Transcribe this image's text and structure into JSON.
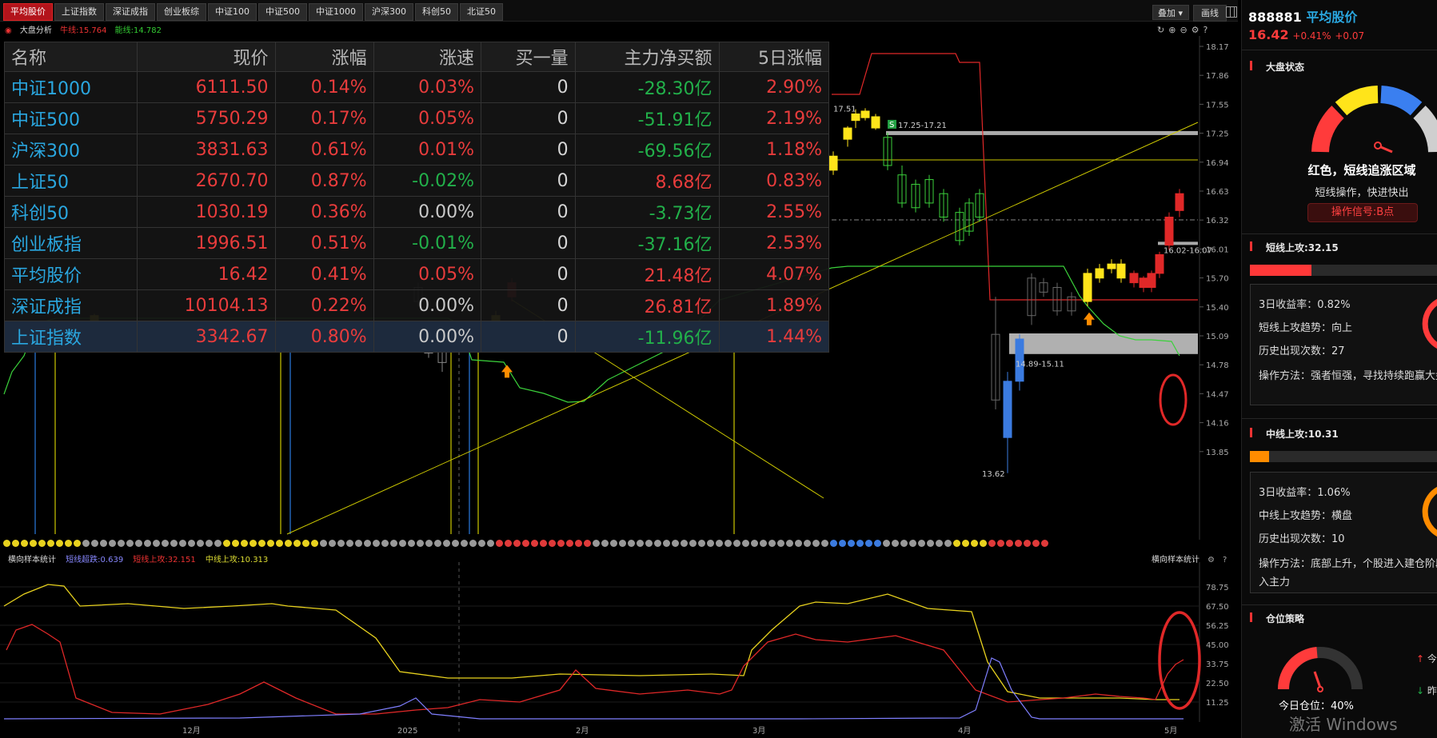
{
  "tabs": [
    "平均股价",
    "上证指数",
    "深证成指",
    "创业板综",
    "中证100",
    "中证500",
    "中证1000",
    "沪深300",
    "科创50",
    "北证50"
  ],
  "toolbar": {
    "overlay_label": "叠加",
    "draw_label": "画线"
  },
  "indicator_bar": {
    "name": "大盘分析",
    "bull_label": "牛线:15.764",
    "energy_label": "能线:14.782"
  },
  "main_chart": {
    "y_ticks": [
      "18.17",
      "17.86",
      "17.55",
      "17.25",
      "16.94",
      "16.63",
      "16.32",
      "16.01",
      "15.70",
      "15.40",
      "15.09",
      "14.78",
      "14.47",
      "14.16",
      "13.85"
    ],
    "annotations": {
      "high": "17.51",
      "resistance": "17.25-17.21",
      "support": "14.89-15.11",
      "range": "16.02-16.07",
      "low": "13.62"
    },
    "resistance_marker": "S"
  },
  "dot_colors": [
    "#e8d21e",
    "#e8d21e",
    "#e8d21e",
    "#e8d21e",
    "#e8d21e",
    "#e8d21e",
    "#e8d21e",
    "#e8d21e",
    "#e8d21e",
    "#999",
    "#999",
    "#999",
    "#999",
    "#999",
    "#999",
    "#999",
    "#999",
    "#999",
    "#999",
    "#999",
    "#999",
    "#999",
    "#999",
    "#999",
    "#999",
    "#e8d21e",
    "#e8d21e",
    "#e8d21e",
    "#e8d21e",
    "#e8d21e",
    "#e8d21e",
    "#e8d21e",
    "#e8d21e",
    "#e8d21e",
    "#e8d21e",
    "#e8d21e",
    "#999",
    "#999",
    "#999",
    "#999",
    "#999",
    "#999",
    "#999",
    "#999",
    "#999",
    "#999",
    "#999",
    "#999",
    "#999",
    "#999",
    "#999",
    "#999",
    "#999",
    "#999",
    "#999",
    "#999",
    "#e03a3a",
    "#e03a3a",
    "#e03a3a",
    "#e03a3a",
    "#e03a3a",
    "#e03a3a",
    "#e03a3a",
    "#e03a3a",
    "#e03a3a",
    "#e03a3a",
    "#e03a3a",
    "#999",
    "#999",
    "#999",
    "#999",
    "#999",
    "#999",
    "#999",
    "#999",
    "#999",
    "#999",
    "#999",
    "#999",
    "#999",
    "#999",
    "#999",
    "#999",
    "#999",
    "#999",
    "#999",
    "#999",
    "#999",
    "#999",
    "#999",
    "#999",
    "#999",
    "#999",
    "#999",
    "#3b7be0",
    "#3b7be0",
    "#3b7be0",
    "#3b7be0",
    "#3b7be0",
    "#3b7be0",
    "#999",
    "#999",
    "#999",
    "#999",
    "#999",
    "#999",
    "#999",
    "#999",
    "#e8d21e",
    "#e8d21e",
    "#e8d21e",
    "#e8d21e",
    "#e03a3a",
    "#e03a3a",
    "#e03a3a",
    "#e03a3a",
    "#e03a3a",
    "#e03a3a",
    "#e03a3a"
  ],
  "sub_chart": {
    "title": "横向样本统计",
    "right_title": "横向样本统计",
    "short_down": "短线超跌:0.639",
    "short_up": "短线上攻:32.151",
    "mid_up": "中线上攻:10.313",
    "y_ticks": [
      "78.75",
      "67.50",
      "56.25",
      "45.00",
      "33.75",
      "22.50",
      "11.25"
    ],
    "x_labels": [
      "12月",
      "2025",
      "2月",
      "3月",
      "4月",
      "5月"
    ]
  },
  "index_table": {
    "headers": [
      "名称",
      "现价",
      "涨幅",
      "涨速",
      "买一量",
      "主力净买额",
      "5日涨幅"
    ],
    "rows": [
      {
        "name": "中证1000",
        "price": "6111.50",
        "chg": "0.14%",
        "speed": "0.03%",
        "bid": "0",
        "net": "-28.30亿",
        "d5": "2.90%"
      },
      {
        "name": "中证500",
        "price": "5750.29",
        "chg": "0.17%",
        "speed": "0.05%",
        "bid": "0",
        "net": "-51.91亿",
        "d5": "2.19%"
      },
      {
        "name": "沪深300",
        "price": "3831.63",
        "chg": "0.61%",
        "speed": "0.01%",
        "bid": "0",
        "net": "-69.56亿",
        "d5": "1.18%"
      },
      {
        "name": "上证50",
        "price": "2670.70",
        "chg": "0.87%",
        "speed": "-0.02%",
        "bid": "0",
        "net": "8.68亿",
        "d5": "0.83%"
      },
      {
        "name": "科创50",
        "price": "1030.19",
        "chg": "0.36%",
        "speed": "0.00%",
        "bid": "0",
        "net": "-3.73亿",
        "d5": "2.55%"
      },
      {
        "name": "创业板指",
        "price": "1996.51",
        "chg": "0.51%",
        "speed": "-0.01%",
        "bid": "0",
        "net": "-37.16亿",
        "d5": "2.53%"
      },
      {
        "name": "平均股价",
        "price": "16.42",
        "chg": "0.41%",
        "speed": "0.05%",
        "bid": "0",
        "net": "21.48亿",
        "d5": "4.07%"
      },
      {
        "name": "深证成指",
        "price": "10104.13",
        "chg": "0.22%",
        "speed": "0.00%",
        "bid": "0",
        "net": "26.81亿",
        "d5": "1.89%"
      },
      {
        "name": "上证指数",
        "price": "3342.67",
        "chg": "0.80%",
        "speed": "0.00%",
        "bid": "0",
        "net": "-11.96亿",
        "d5": "1.44%"
      }
    ]
  },
  "right_panel": {
    "code": "888881",
    "name": "平均股价",
    "price": "16.42",
    "pct": "+0.41%",
    "change": "+0.07",
    "market_status": {
      "title": "大盘状态",
      "status_text": "红色，短线追涨区域",
      "advice": "短线操作，快进快出",
      "signal": "操作信号:B点"
    },
    "short_attack": {
      "title": "短线上攻:32.15",
      "progress": 0.32,
      "return_3d": "3日收益率：0.82%",
      "trend": "短线上攻趋势：向上",
      "count": "历史出现次数：27",
      "method": "操作方法：强者恒强，寻找持续跑赢大盘"
    },
    "mid_attack": {
      "title": "中线上攻:10.31",
      "progress": 0.1,
      "return_3d": "3日收益率：1.06%",
      "trend": "中线上攻趋势：横盘",
      "count": "历史出现次数：10",
      "method": "操作方法：底部上升，个股进入建仓阶段",
      "method2": "入主力"
    },
    "position": {
      "title": "仓位策略",
      "today": "今日仓位：40%",
      "right1": "今",
      "right2": "昨"
    }
  },
  "watermark": "激活 Windows"
}
